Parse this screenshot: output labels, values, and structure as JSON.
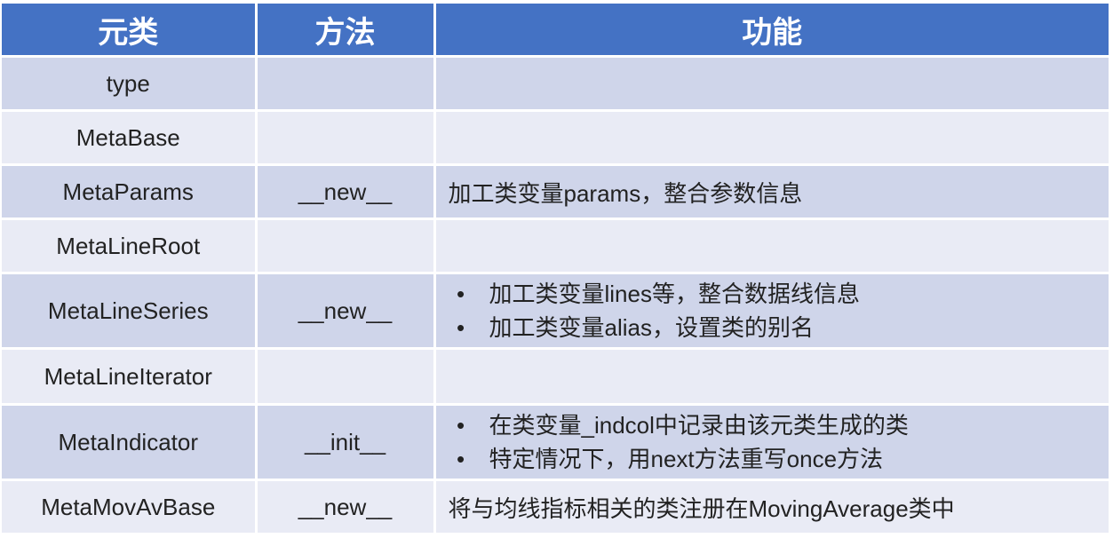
{
  "header": {
    "col1": "元类",
    "col2": "方法",
    "col3": "功能"
  },
  "rows": [
    {
      "name": "type",
      "method": "",
      "func": []
    },
    {
      "name": "MetaBase",
      "method": "",
      "func": []
    },
    {
      "name": "MetaParams",
      "method": "__new__",
      "func": [
        "加工类变量params，整合参数信息"
      ]
    },
    {
      "name": "MetaLineRoot",
      "method": "",
      "func": []
    },
    {
      "name": "MetaLineSeries",
      "method": "__new__",
      "func": [
        "加工类变量lines等，整合数据线信息",
        "加工类变量alias，设置类的别名"
      ]
    },
    {
      "name": "MetaLineIterator",
      "method": "",
      "func": []
    },
    {
      "name": "MetaIndicator",
      "method": "__init__",
      "func": [
        "在类变量_indcol中记录由该元类生成的类",
        "特定情况下，用next方法重写once方法"
      ]
    },
    {
      "name": "MetaMovAvBase",
      "method": "__new__",
      "func": [
        "将与均线指标相关的类注册在MovingAverage类中"
      ]
    }
  ],
  "bullet_glyph": "•",
  "colors": {
    "header_bg": "#4472c4",
    "row_dark": "#cfd5ea",
    "row_light": "#e9ebf5"
  }
}
